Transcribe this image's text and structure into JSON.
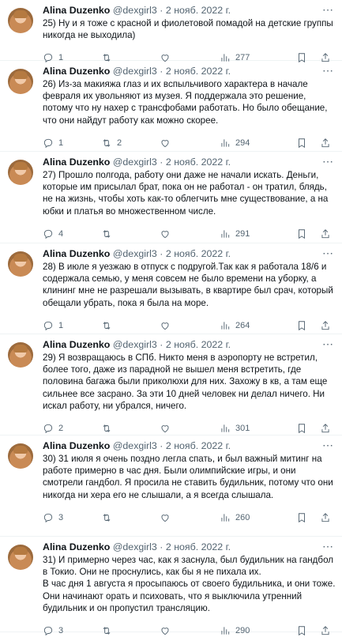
{
  "author": {
    "name": "Alina Duzenko",
    "handle": "@dexgirl3",
    "date": "2 нояб. 2022 г."
  },
  "separator": "·",
  "tweets": [
    {
      "text": "25) Ну и я тоже с красной и фиолетовой помадой на детские группы никогда не выходила)",
      "replies": "1",
      "retweets": "",
      "likes": "",
      "views": "277"
    },
    {
      "text": "26) Из-за макияжа глаз и их вспыльчивого характера в начале февраля их увольняют из музея. Я поддержала это решение, потому что ну нахер с трансфобами работать. Но было обещание, что они найдут работу как можно скорее.",
      "replies": "1",
      "retweets": "2",
      "likes": "",
      "views": "294"
    },
    {
      "text": "27) Прошло полгода, работу они даже не начали искать. Деньги, которые им присылал брат, пока он не работал - он тратил, блядь, не на жизнь, чтобы хоть как-то облегчить мне существование, а на юбки и платья во множественном числе.",
      "replies": "4",
      "retweets": "",
      "likes": "",
      "views": "291"
    },
    {
      "text": "28) В июле я уезжаю в отпуск с подругой.Так как я работала 18/6 и содержала семью, у меня совсем не было времени на уборку, а клининг мне не разрешали вызывать, в квартире был срач, который обещали убрать, пока я была на море.",
      "replies": "1",
      "retweets": "",
      "likes": "",
      "views": "264"
    },
    {
      "text": "29) Я возвращаюсь в СПб. Никто меня в аэропорту не встретил, более того, даже из парадной не вышел меня встретить, где половина багажа были приколюхи для них. Захожу в кв, а там еще сильнее все засрано. За эти 10 дней человек ни делал ничего. Ни искал работу, ни убрался, ничего.",
      "replies": "2",
      "retweets": "",
      "likes": "",
      "views": "301"
    },
    {
      "text": "30) 31 июля я очень поздно легла спать, и был важный митинг на работе примерно в час дня. Были олимпийские игры, и они смотрели гандбол. Я просила не ставить будильник, потому что они никогда ни хера его не слышали, а я всегда слышала.",
      "replies": "3",
      "retweets": "",
      "likes": "",
      "views": "260"
    },
    {
      "text": "31) И примерно через час, как я заснула, был будильник на гандбол в Токио. Они не проснулись, как бы я не пихала их.\nВ час дня 1 августа я просыпаюсь от своего будильника, и они тоже.\nОни начинают орать и психовать, что я выключила утренний будильник и он пропустил трансляцию.",
      "replies": "3",
      "retweets": "",
      "likes": "",
      "views": "290"
    }
  ],
  "icons": [
    "more-icon",
    "reply-icon",
    "retweet-icon",
    "like-icon",
    "views-icon",
    "bookmark-icon",
    "share-icon"
  ]
}
